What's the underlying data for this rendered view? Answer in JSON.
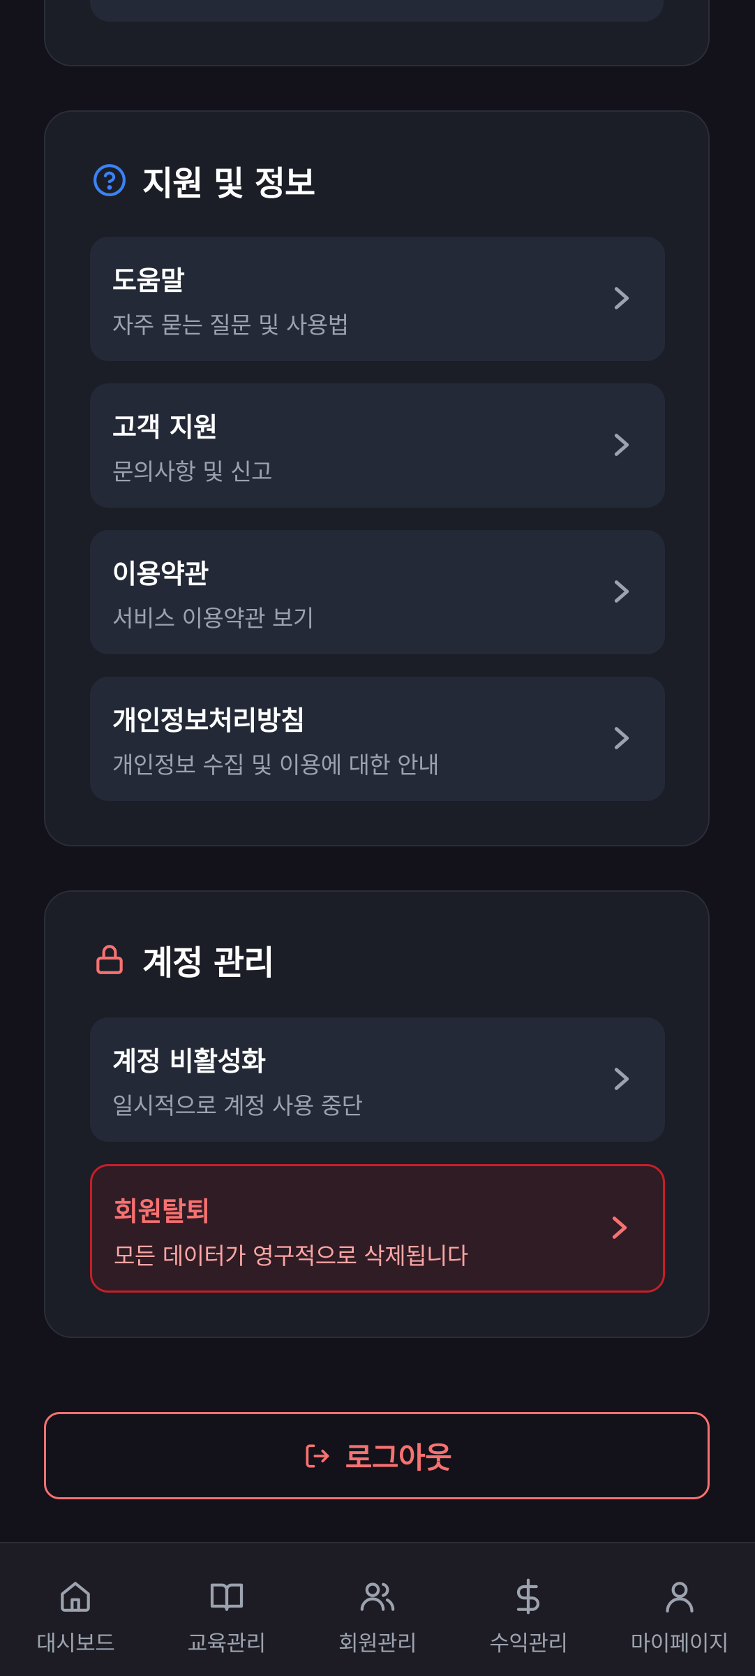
{
  "colors": {
    "background": "#13121a",
    "card": "#1b1e26",
    "item": "#232936",
    "accent_blue": "#3b82f6",
    "danger": "#f87171",
    "muted": "#9ca3af"
  },
  "support": {
    "title": "지원 및 정보",
    "icon": "question-circle-icon",
    "items": [
      {
        "title": "도움말",
        "subtitle": "자주 묻는 질문 및 사용법"
      },
      {
        "title": "고객 지원",
        "subtitle": "문의사항 및 신고"
      },
      {
        "title": "이용약관",
        "subtitle": "서비스 이용약관 보기"
      },
      {
        "title": "개인정보처리방침",
        "subtitle": "개인정보 수집 및 이용에 대한 안내"
      }
    ]
  },
  "account": {
    "title": "계정 관리",
    "icon": "lock-icon",
    "items": [
      {
        "title": "계정 비활성화",
        "subtitle": "일시적으로 계정 사용 중단"
      },
      {
        "title": "회원탈퇴",
        "subtitle": "모든 데이터가 영구적으로 삭제됩니다"
      }
    ]
  },
  "logout": {
    "label": "로그아웃",
    "icon": "logout-icon"
  },
  "tabbar": {
    "tabs": [
      {
        "label": "대시보드",
        "icon": "home-icon"
      },
      {
        "label": "교육관리",
        "icon": "book-icon"
      },
      {
        "label": "회원관리",
        "icon": "users-icon"
      },
      {
        "label": "수익관리",
        "icon": "dollar-icon"
      },
      {
        "label": "마이페이지",
        "icon": "user-icon"
      }
    ]
  }
}
